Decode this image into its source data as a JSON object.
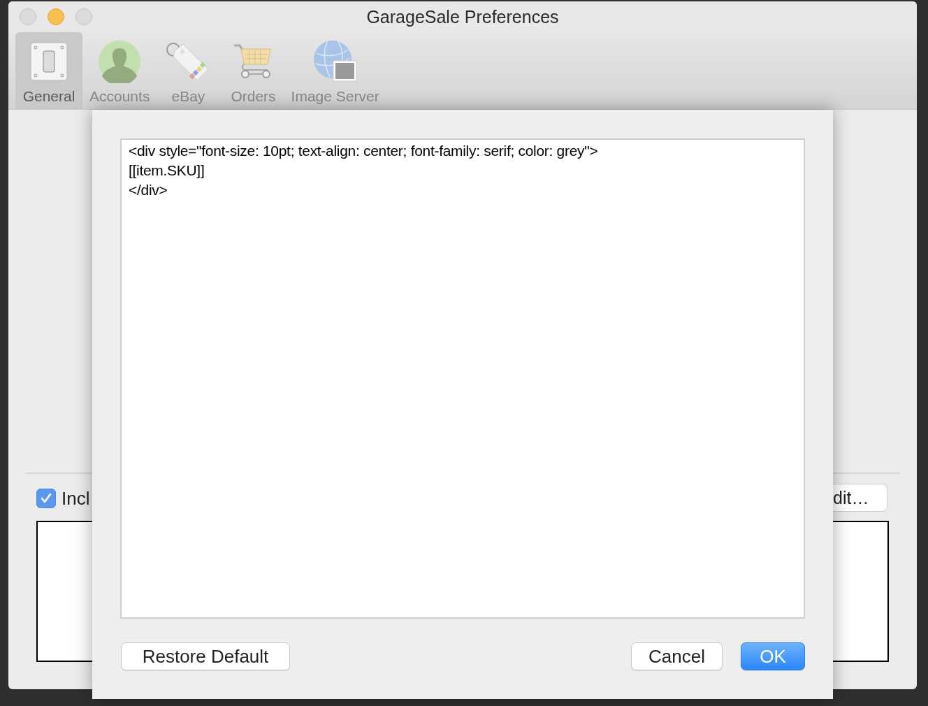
{
  "window": {
    "title": "GarageSale Preferences"
  },
  "toolbar": [
    {
      "label": "General",
      "kind": "switch",
      "selected": true
    },
    {
      "label": "Accounts",
      "kind": "person",
      "selected": false
    },
    {
      "label": "eBay",
      "kind": "tag",
      "selected": false
    },
    {
      "label": "Orders",
      "kind": "cart",
      "selected": false
    },
    {
      "label": "Image Server",
      "kind": "globe",
      "selected": false
    }
  ],
  "background": {
    "checkbox": {
      "label": "Incl",
      "checked": true
    },
    "button": "dit…"
  },
  "sheet": {
    "editor": {
      "value": "<div style=\"font-size: 10pt; text-align: center; font-family: serif; color: grey\">\n[[item.SKU]]\n</div>"
    },
    "buttons": [
      {
        "label": "Restore Default",
        "kind": "plain"
      },
      {
        "label": "Cancel",
        "kind": "plain"
      },
      {
        "label": "OK",
        "kind": "default"
      }
    ]
  }
}
